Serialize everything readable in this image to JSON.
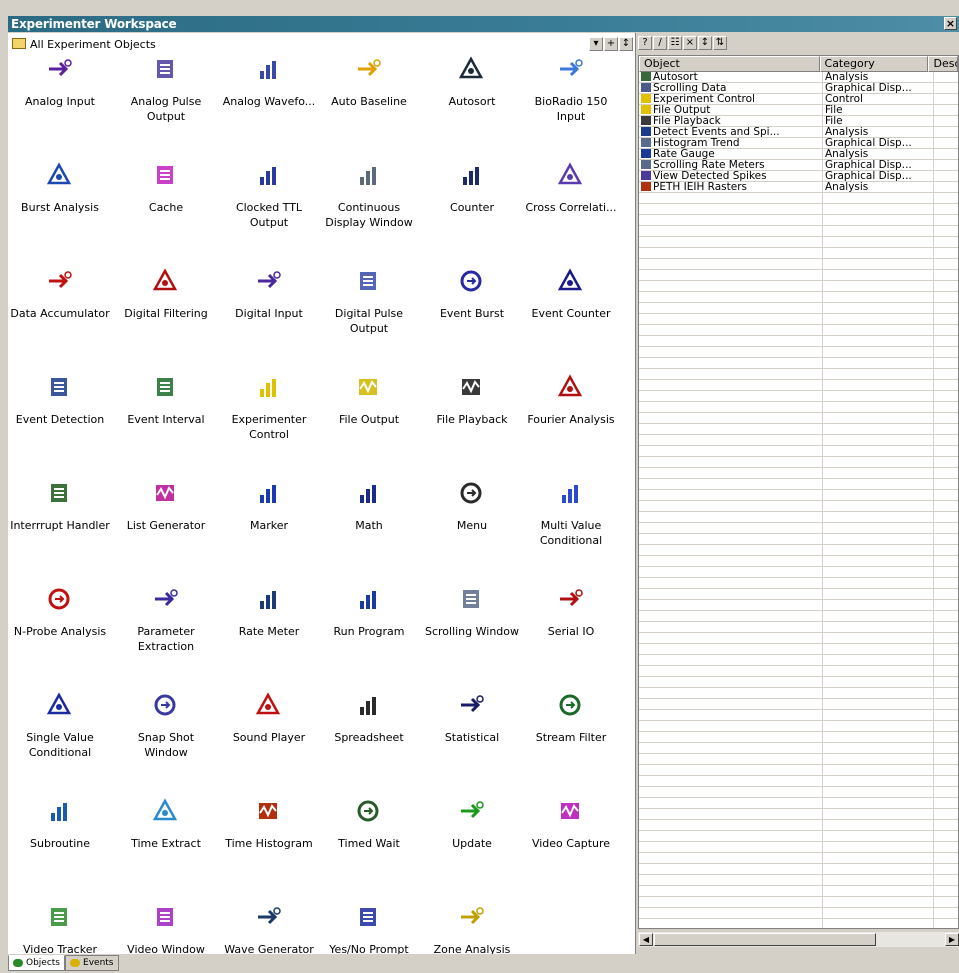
{
  "window": {
    "title": "Experimenter Workspace",
    "close_glyph": "×"
  },
  "left_pane": {
    "header": "All Experiment Objects"
  },
  "toolbar_left": [
    {
      "icon": "dropdown-arrow-icon",
      "glyph": "▾"
    },
    {
      "icon": "add-icon",
      "glyph": "+"
    },
    {
      "icon": "sort-icon",
      "glyph": "↕"
    }
  ],
  "toolbar_right": [
    {
      "icon": "help-icon",
      "glyph": "?"
    },
    {
      "icon": "edit-icon",
      "glyph": "/"
    },
    {
      "icon": "properties-icon",
      "glyph": "☷"
    },
    {
      "icon": "delete-icon",
      "glyph": "×"
    },
    {
      "icon": "sort-az-icon",
      "glyph": "↕"
    },
    {
      "icon": "sort-type-icon",
      "glyph": "⇅"
    }
  ],
  "objects": [
    {
      "label": "Analog Input",
      "icon": "analog-input-icon",
      "color": "#5a1f9e"
    },
    {
      "label": "Analog Pulse Output",
      "icon": "analog-pulse-output-icon",
      "color": "#4a3a9e"
    },
    {
      "label": "Analog Wavefo...",
      "icon": "analog-waveform-icon",
      "color": "#3a48a8"
    },
    {
      "label": "Auto Baseline",
      "icon": "auto-baseline-icon",
      "color": "#e0a000"
    },
    {
      "label": "Autosort",
      "icon": "autosort-icon",
      "color": "#1a2a3a"
    },
    {
      "label": "BioRadio 150 Input",
      "icon": "bioradio-icon",
      "color": "#3a7adc"
    },
    {
      "label": "Burst Analysis",
      "icon": "burst-analysis-icon",
      "color": "#1a4ab0"
    },
    {
      "label": "Cache",
      "icon": "cache-icon",
      "color": "#c020c0"
    },
    {
      "label": "Clocked TTL Output",
      "icon": "clocked-ttl-icon",
      "color": "#2a3a9e"
    },
    {
      "label": "Continuous Display Window",
      "icon": "continuous-display-icon",
      "color": "#5a6a7a"
    },
    {
      "label": "Counter",
      "icon": "counter-icon",
      "color": "#1a2a6a"
    },
    {
      "label": "Cross Correlati...",
      "icon": "cross-correlation-icon",
      "color": "#5a3ab0"
    },
    {
      "label": "Data Accumulator",
      "icon": "data-accumulator-icon",
      "color": "#c01010"
    },
    {
      "label": "Digital Filtering",
      "icon": "digital-filtering-icon",
      "color": "#b01010"
    },
    {
      "label": "Digital Input",
      "icon": "digital-input-icon",
      "color": "#4a2a9e"
    },
    {
      "label": "Digital Pulse Output",
      "icon": "digital-pulse-output-icon",
      "color": "#3a4aa8"
    },
    {
      "label": "Event Burst",
      "icon": "event-burst-icon",
      "color": "#2a2aa0"
    },
    {
      "label": "Event Counter",
      "icon": "event-counter-icon",
      "color": "#1a1a8a"
    },
    {
      "label": "Event Detection",
      "icon": "event-detection-icon",
      "color": "#1a3a8a"
    },
    {
      "label": "Event Interval",
      "icon": "event-interval-icon",
      "color": "#1a6a2a"
    },
    {
      "label": "Experimenter Control",
      "icon": "experimenter-control-icon",
      "color": "#e0c000"
    },
    {
      "label": "File Output",
      "icon": "file-output-icon",
      "color": "#d8c020"
    },
    {
      "label": "File Playback",
      "icon": "file-playback-icon",
      "color": "#3a3a3a"
    },
    {
      "label": "Fourier Analysis",
      "icon": "fourier-analysis-icon",
      "color": "#b01010"
    },
    {
      "label": "Interrrupt Handler",
      "icon": "interrupt-handler-icon",
      "color": "#1a5a1a"
    },
    {
      "label": "List Generator",
      "icon": "list-generator-icon",
      "color": "#c030a0"
    },
    {
      "label": "Marker",
      "icon": "marker-icon",
      "color": "#1a3ab0"
    },
    {
      "label": "Math",
      "icon": "math-icon",
      "color": "#1a2a8a"
    },
    {
      "label": "Menu",
      "icon": "menu-icon",
      "color": "#2a2a2a"
    },
    {
      "label": "Multi Value Conditional",
      "icon": "multi-value-conditional-icon",
      "color": "#2a4ad0"
    },
    {
      "label": "N-Probe Analysis",
      "icon": "nprobe-analysis-icon",
      "color": "#c01010"
    },
    {
      "label": "Parameter Extraction",
      "icon": "parameter-extraction-icon",
      "color": "#3a2a9e"
    },
    {
      "label": "Rate Meter",
      "icon": "rate-meter-icon",
      "color": "#1a3a7a"
    },
    {
      "label": "Run Program",
      "icon": "run-program-icon",
      "color": "#1a3aa0"
    },
    {
      "label": "Scrolling Window",
      "icon": "scrolling-window-icon",
      "color": "#5a6a8a"
    },
    {
      "label": "Serial IO",
      "icon": "serial-io-icon",
      "color": "#b01010"
    },
    {
      "label": "Single Value Conditional",
      "icon": "single-value-conditional-icon",
      "color": "#1a2aa0"
    },
    {
      "label": "Snap Shot Window",
      "icon": "snapshot-window-icon",
      "color": "#3a3a9e"
    },
    {
      "label": "Sound Player",
      "icon": "sound-player-icon",
      "color": "#c01010"
    },
    {
      "label": "Spreadsheet",
      "icon": "spreadsheet-icon",
      "color": "#2a2a2a"
    },
    {
      "label": "Statistical",
      "icon": "statistical-icon",
      "color": "#1a1a6a"
    },
    {
      "label": "Stream Filter",
      "icon": "stream-filter-icon",
      "color": "#1a6a2a"
    },
    {
      "label": "Subroutine",
      "icon": "subroutine-icon",
      "color": "#1a5ab0"
    },
    {
      "label": "Time Extract",
      "icon": "time-extract-icon",
      "color": "#2a8ad0"
    },
    {
      "label": "Time Histogram",
      "icon": "time-histogram-icon",
      "color": "#b03010"
    },
    {
      "label": "Timed Wait",
      "icon": "timed-wait-icon",
      "color": "#2a5a2a"
    },
    {
      "label": "Update",
      "icon": "update-icon",
      "color": "#1a9a1a"
    },
    {
      "label": "Video Capture",
      "icon": "video-capture-icon",
      "color": "#c030c0"
    },
    {
      "label": "Video Tracker",
      "icon": "video-tracker-icon",
      "color": "#2a8a2a"
    },
    {
      "label": "Video Window",
      "icon": "video-window-icon",
      "color": "#a020c0"
    },
    {
      "label": "Wave Generator",
      "icon": "wave-generator-icon",
      "color": "#1a3a6a"
    },
    {
      "label": "Yes/No Prompt",
      "icon": "yes-no-prompt-icon",
      "color": "#1a2aa0"
    },
    {
      "label": "Zone Analysis",
      "icon": "zone-analysis-icon",
      "color": "#c0a000"
    }
  ],
  "table": {
    "columns": [
      "Object",
      "Category",
      "Desc"
    ],
    "rows": [
      {
        "object": "Autosort",
        "category": "Analysis",
        "icon": "autosort-icon",
        "color": "#3a6a3a"
      },
      {
        "object": "Scrolling Data",
        "category": "Graphical Disp...",
        "icon": "scrolling-window-icon",
        "color": "#4a5a8a"
      },
      {
        "object": "Experiment Control",
        "category": "Control",
        "icon": "experimenter-control-icon",
        "color": "#e0c000"
      },
      {
        "object": "File Output",
        "category": "File",
        "icon": "file-output-icon",
        "color": "#e0c000"
      },
      {
        "object": "File Playback",
        "category": "File",
        "icon": "file-playback-icon",
        "color": "#3a3a3a"
      },
      {
        "object": "Detect Events and Spi...",
        "category": "Analysis",
        "icon": "event-detection-icon",
        "color": "#1a3a8a"
      },
      {
        "object": "Histogram Trend",
        "category": "Graphical Disp...",
        "icon": "scrolling-window-icon",
        "color": "#5a6a8a"
      },
      {
        "object": "Rate Gauge",
        "category": "Analysis",
        "icon": "rate-meter-icon",
        "color": "#1a3a9a"
      },
      {
        "object": "Scrolling Rate Meters",
        "category": "Graphical Disp...",
        "icon": "scrolling-window-icon",
        "color": "#5a6a8a"
      },
      {
        "object": "View Detected Spikes",
        "category": "Graphical Disp...",
        "icon": "snapshot-window-icon",
        "color": "#4a3a9e"
      },
      {
        "object": "PETH IEIH Rasters",
        "category": "Analysis",
        "icon": "time-histogram-icon",
        "color": "#b03010"
      }
    ]
  },
  "tabs": [
    {
      "label": "Objects",
      "icon": "objects-tab-icon",
      "color": "#2a8a2a",
      "active": true
    },
    {
      "label": "Events",
      "icon": "events-tab-icon",
      "color": "#d8b000",
      "active": false
    }
  ]
}
